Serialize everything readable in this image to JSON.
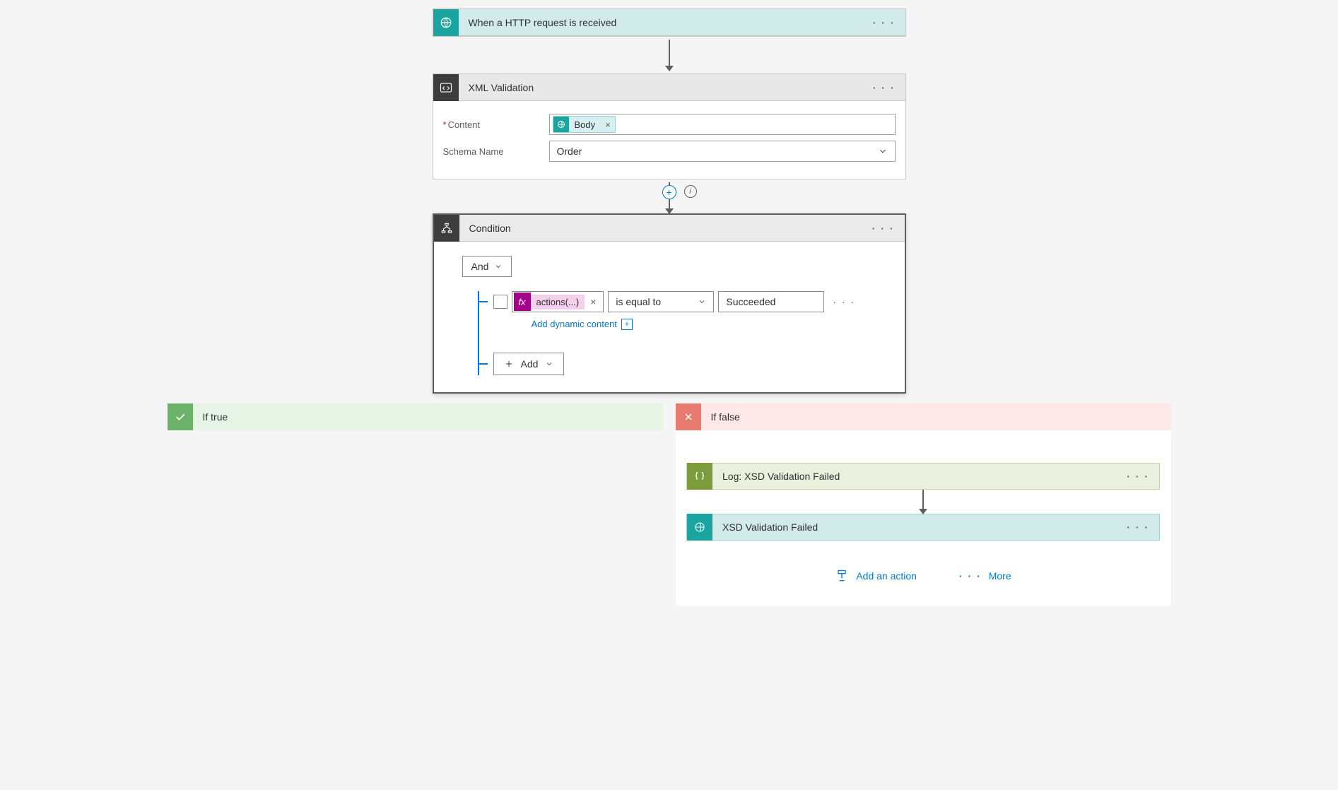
{
  "trigger": {
    "title": "When a HTTP request is received",
    "more": "· · ·"
  },
  "xmlValidation": {
    "title": "XML Validation",
    "more": "· · ·",
    "contentLabel": "Content",
    "schemaLabel": "Schema Name",
    "schemaValue": "Order",
    "bodyToken": "Body",
    "tokenX": "×"
  },
  "condition": {
    "title": "Condition",
    "more": "· · ·",
    "andLabel": "And",
    "fxBadge": "fx",
    "fxLabel": "actions(...)",
    "fxX": "×",
    "operator": "is equal to",
    "value": "Succeeded",
    "rowMore": "· · ·",
    "dynContent": "Add dynamic content",
    "addLabel": "Add"
  },
  "branches": {
    "trueTitle": "If true",
    "falseTitle": "If false",
    "logTitle": "Log: XSD Validation Failed",
    "respTitle": "XSD Validation Failed",
    "more": "· · ·",
    "addAction": "Add an action",
    "moreLink": "More"
  }
}
